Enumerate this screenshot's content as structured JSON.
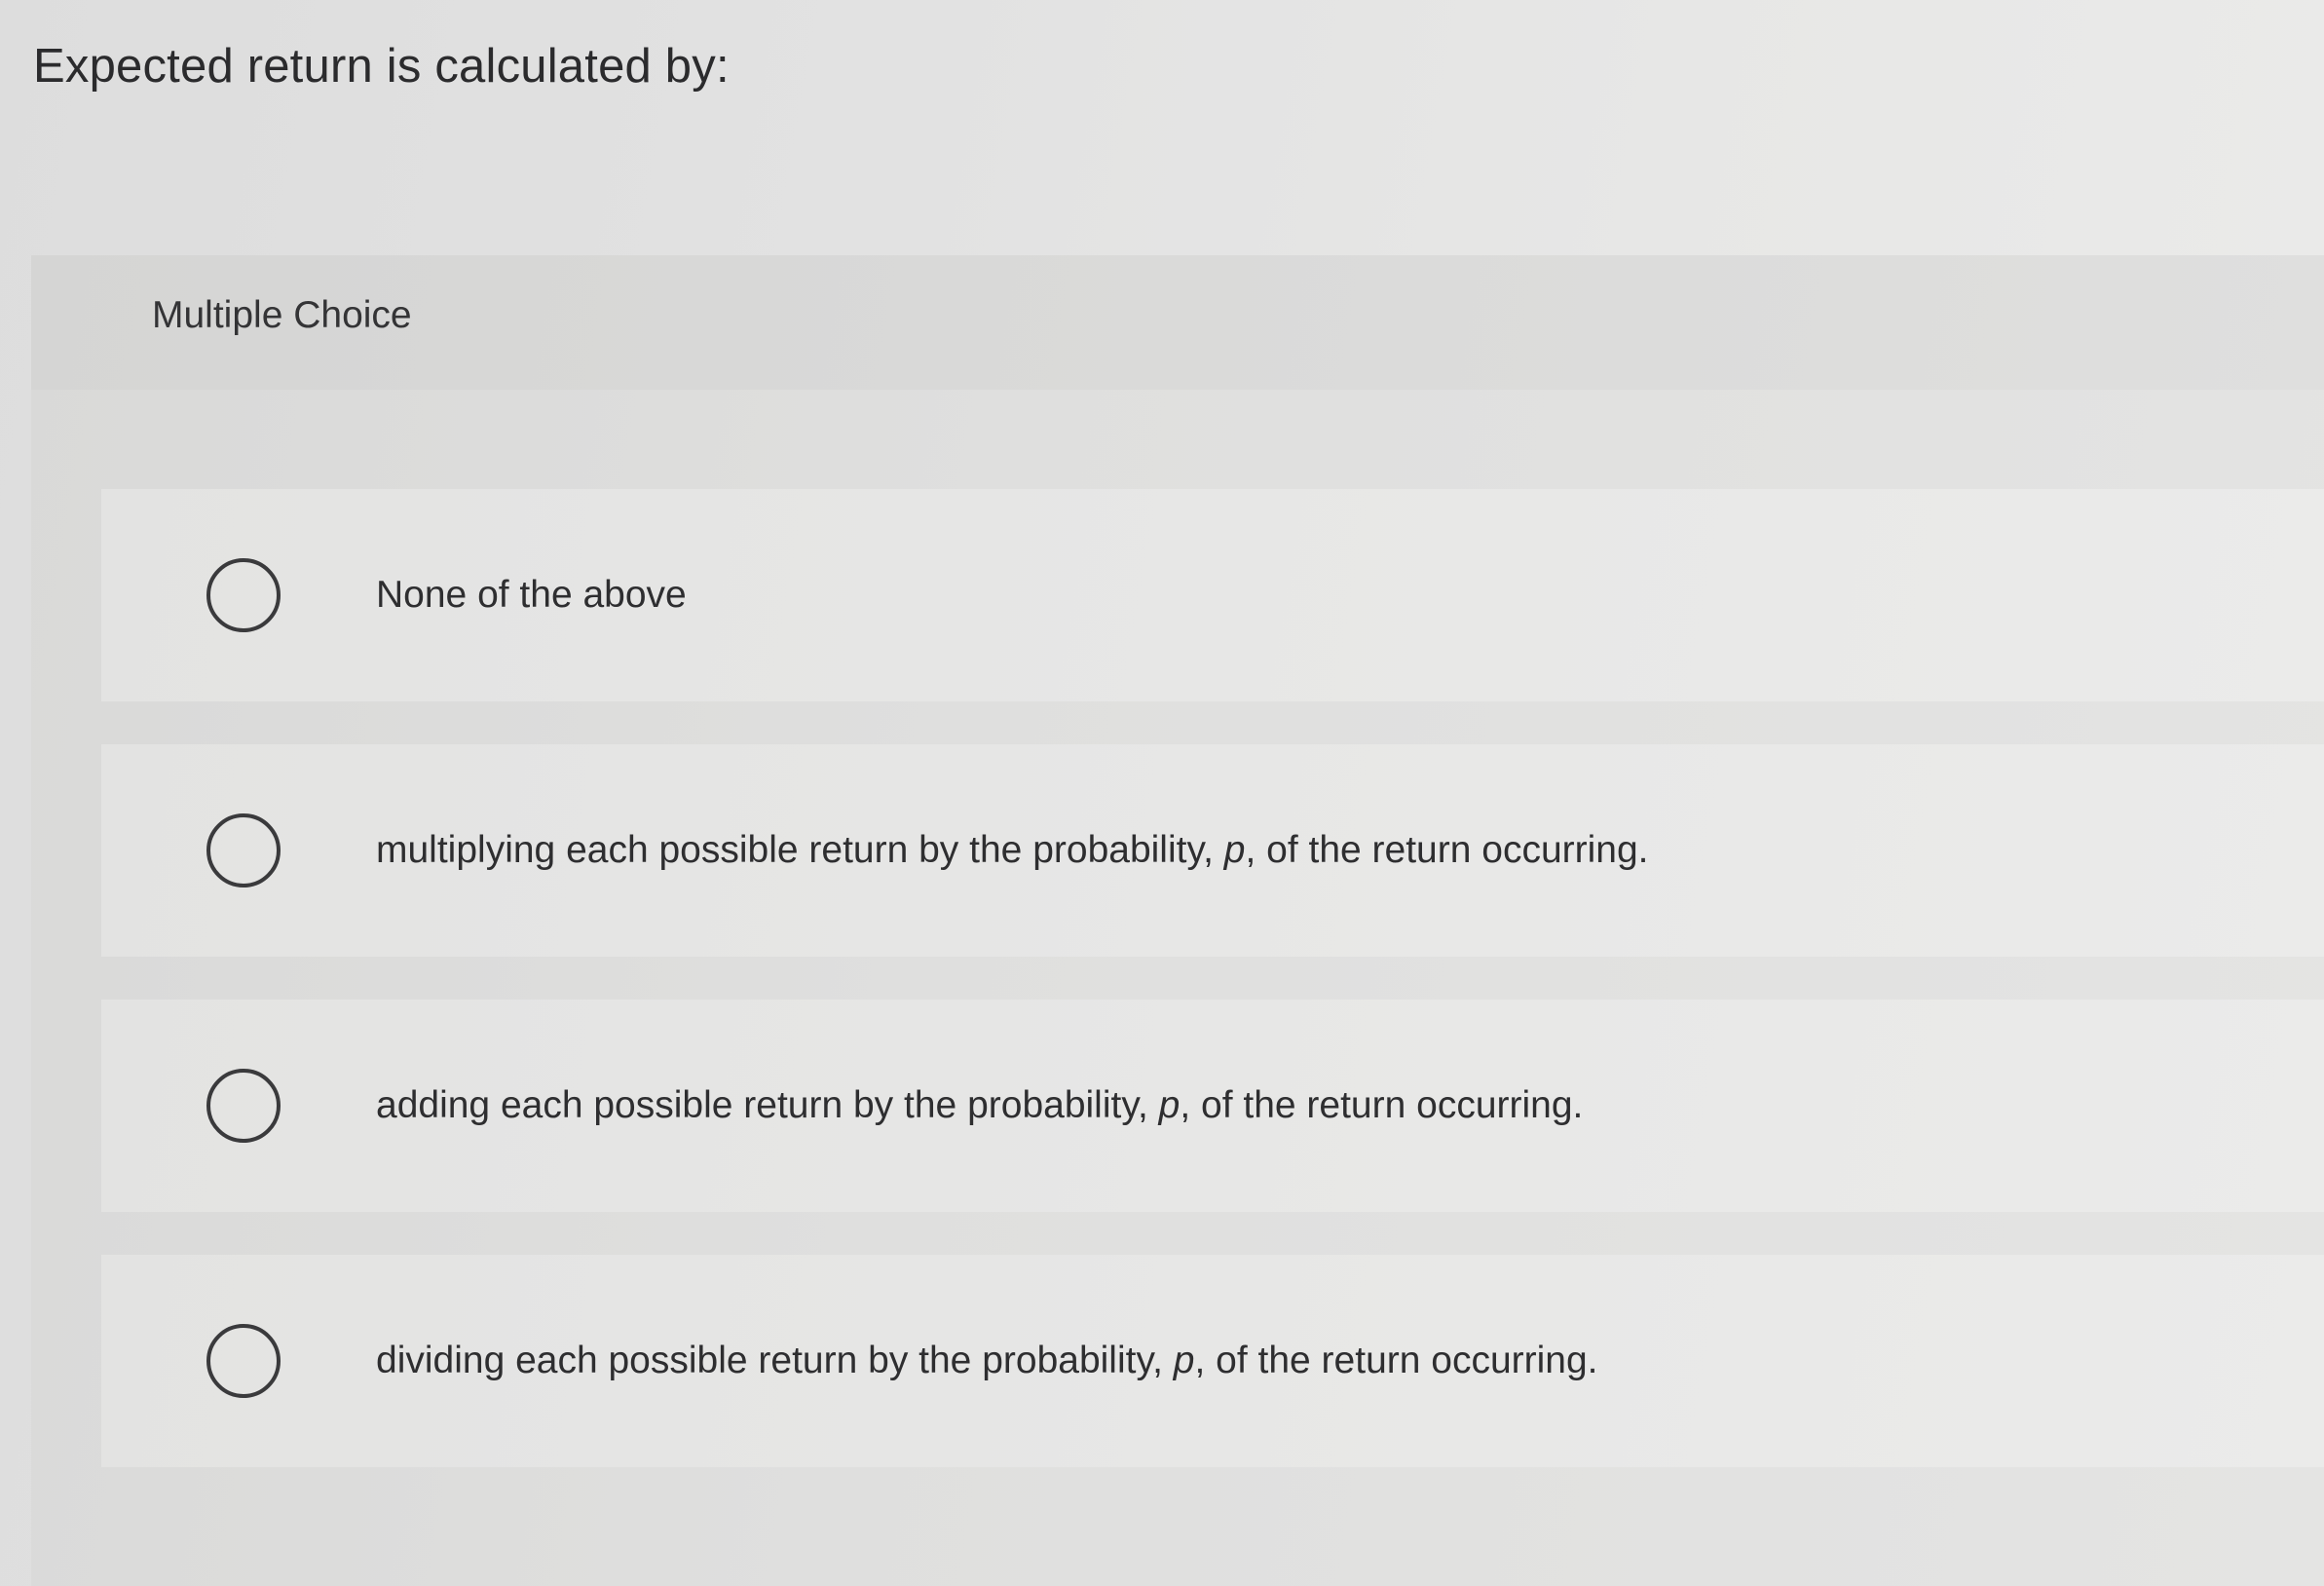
{
  "question": {
    "text": "Expected return is calculated by:"
  },
  "panel": {
    "label": "Multiple Choice"
  },
  "options": [
    {
      "text": "None of the above",
      "selected": false
    },
    {
      "text_before": "multiplying each possible return by the probability, ",
      "variable": "p",
      "text_after": ", of the return occurring.",
      "selected": false
    },
    {
      "text_before": "adding each possible return by the probability, ",
      "variable": "p",
      "text_after": ", of the return occurring.",
      "selected": false
    },
    {
      "text_before": "dividing each possible return by the probability, ",
      "variable": "p",
      "text_after": ", of the return occurring.",
      "selected": false
    }
  ]
}
